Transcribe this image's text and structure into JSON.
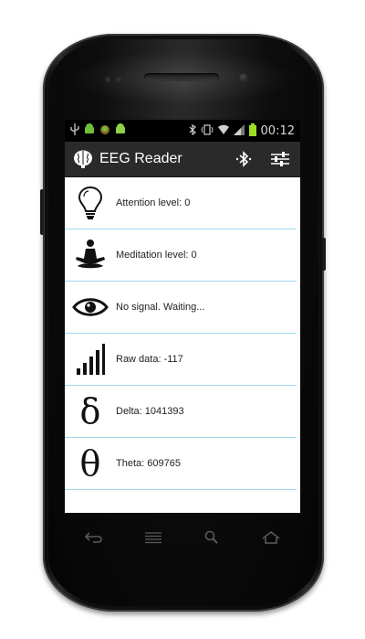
{
  "status_bar": {
    "time": "00:12",
    "left_icons": [
      "usb-icon",
      "android-icon",
      "android-debug-icon",
      "android-icon"
    ],
    "right_icons": [
      "bluetooth-icon",
      "vibrate-icon",
      "wifi-icon",
      "signal-icon",
      "battery-icon"
    ]
  },
  "action_bar": {
    "title": "EEG Reader",
    "background": "#2a2a2a",
    "actions": [
      "bluetooth-connect-icon",
      "settings-sliders-icon"
    ]
  },
  "list": {
    "divider_color": "#9fd9ef",
    "items": [
      {
        "icon": "lightbulb-icon",
        "label": "Attention level: 0"
      },
      {
        "icon": "meditation-icon",
        "label": "Meditation level: 0"
      },
      {
        "icon": "eye-icon",
        "label": "No signal. Waiting..."
      },
      {
        "icon": "signal-bars-icon",
        "label": "Raw data: -117"
      },
      {
        "icon": "delta-icon",
        "glyph": "δ",
        "label": "Delta: 1041393"
      },
      {
        "icon": "theta-icon",
        "glyph": "θ",
        "label": "Theta: 609765"
      }
    ]
  },
  "nav_bar": {
    "buttons": [
      "back-icon",
      "menu-icon",
      "search-icon",
      "home-icon"
    ]
  }
}
